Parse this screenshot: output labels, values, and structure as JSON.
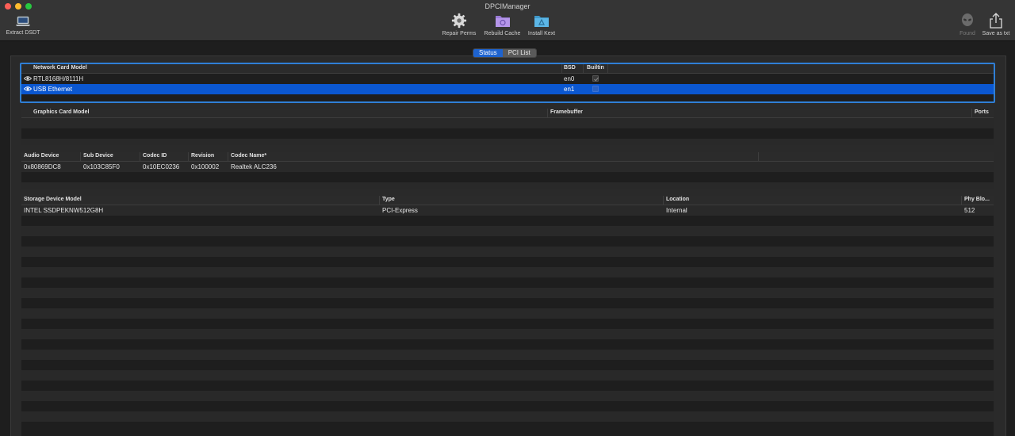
{
  "window": {
    "title": "DPCIManager"
  },
  "toolbar": {
    "extract_dsdt": "Extract DSDT",
    "repair_perms": "Repair Perms",
    "rebuild_cache": "Rebuild Cache",
    "install_kext": "Install Kext",
    "found": "Found",
    "save_as_txt": "Save as txt"
  },
  "tabs": {
    "status": "Status",
    "pci_list": "PCI List"
  },
  "network": {
    "headers": {
      "model": "Network Card Model",
      "bsd": "BSD",
      "builtin": "Builtin"
    },
    "rows": [
      {
        "model": "RTL8168H/8111H",
        "bsd": "en0",
        "builtin": true
      },
      {
        "model": "USB Ethernet",
        "bsd": "en1",
        "builtin": false
      }
    ]
  },
  "graphics": {
    "headers": {
      "model": "Graphics Card Model",
      "framebuffer": "Framebuffer",
      "ports": "Ports"
    }
  },
  "audio": {
    "headers": {
      "device": "Audio Device",
      "sub_device": "Sub Device",
      "codec_id": "Codec ID",
      "revision": "Revision",
      "codec_name": "Codec Name*"
    },
    "rows": [
      {
        "device": "0x80869DC8",
        "sub_device": "0x103C85F0",
        "codec_id": "0x10EC0236",
        "revision": "0x100002",
        "codec_name": "Realtek ALC236"
      }
    ]
  },
  "storage": {
    "headers": {
      "model": "Storage Device Model",
      "type": "Type",
      "location": "Location",
      "phy_block": "Phy Blo..."
    },
    "rows": [
      {
        "model": "INTEL SSDPEKNW512G8H",
        "type": "PCI-Express",
        "location": "Internal",
        "phy_block": "512"
      }
    ]
  },
  "colors": {
    "accent": "#0b57d0",
    "focus_ring": "#2f7fd6",
    "background": "#1e1e1e"
  },
  "icons": [
    "laptop-icon",
    "gear-icon",
    "cache-icon",
    "kext-icon",
    "alien-icon",
    "share-icon",
    "eye-icon",
    "checkmark-icon"
  ]
}
